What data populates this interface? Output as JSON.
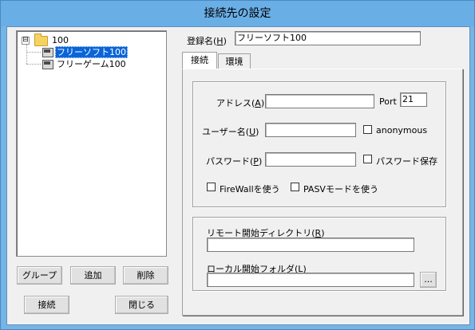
{
  "window": {
    "title": "接続先の設定"
  },
  "tree": {
    "root": {
      "expander": "⊟",
      "label": "100"
    },
    "items": [
      {
        "label": "フリーソフト100",
        "selected": true
      },
      {
        "label": "フリーゲーム100",
        "selected": false
      }
    ]
  },
  "buttons": {
    "group": "グループ",
    "add": "追加",
    "delete": "削除",
    "connect": "接続",
    "close": "閉じる",
    "browse": "..."
  },
  "registration": {
    "label_prefix": "登録名(",
    "label_key": "H",
    "label_suffix": ")",
    "value": "フリーソフト100"
  },
  "tabs": [
    {
      "label": "接続",
      "active": true
    },
    {
      "label": "環境",
      "active": false
    }
  ],
  "connection": {
    "address": {
      "label_prefix": "アドレス(",
      "label_key": "A",
      "label_suffix": ")",
      "value": ""
    },
    "port": {
      "label": "Port",
      "value": "21"
    },
    "username": {
      "label_prefix": "ユーザー名(",
      "label_key": "U",
      "label_suffix": ")",
      "value": ""
    },
    "anonymous": {
      "label": "anonymous",
      "checked": false
    },
    "password": {
      "label_prefix": "パスワード(",
      "label_key": "P",
      "label_suffix": ")",
      "value": ""
    },
    "save_password": {
      "label": "パスワード保存",
      "checked": false
    },
    "firewall": {
      "label": "FireWallを使う",
      "checked": false
    },
    "pasv": {
      "label": "PASVモードを使う",
      "checked": false
    }
  },
  "directories": {
    "remote": {
      "label_prefix": "リモート開始ディレクトリ(",
      "label_key": "R",
      "label_suffix": ")",
      "value": ""
    },
    "local": {
      "label_prefix": "ローカル開始フォルダ(",
      "label_key": "L",
      "label_suffix": ")",
      "value": ""
    }
  }
}
